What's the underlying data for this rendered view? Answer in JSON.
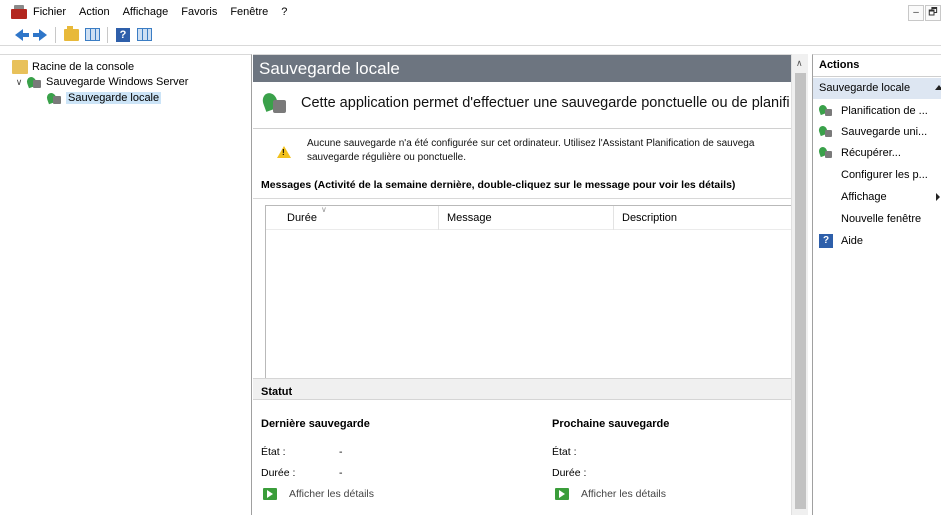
{
  "menu": {
    "items": [
      "Fichier",
      "Action",
      "Affichage",
      "Favoris",
      "Fenêtre",
      "?"
    ]
  },
  "window_controls": [
    "–",
    "🗗"
  ],
  "toolbar": {
    "buttons": [
      "back-arrow-icon",
      "forward-arrow-icon",
      "folder-up-icon",
      "show-hide-tree-icon",
      "help-icon",
      "show-hide-action-pane-icon"
    ]
  },
  "tree": {
    "items": [
      {
        "label": "Racine de la console",
        "icon": "folder-icon"
      },
      {
        "label": "Sauvegarde Windows Server",
        "icon": "windows-backup-icon",
        "expanded": true
      },
      {
        "label": "Sauvegarde locale",
        "icon": "windows-backup-icon",
        "selected": true
      }
    ]
  },
  "center": {
    "title": "Sauvegarde locale",
    "intro": "Cette application permet d'effectuer une sauvegarde ponctuelle ou de planifi",
    "warning": {
      "line1": "Aucune sauvegarde n'a été configurée sur cet ordinateur. Utilisez l'Assistant Planification de sauvega",
      "line2": "sauvegarde régulière ou ponctuelle."
    },
    "messages_title": "Messages (Activité de la semaine dernière, double-cliquez sur le message pour voir les détails)",
    "columns": [
      "Durée",
      "Message",
      "Description"
    ],
    "rows": [],
    "statut_title": "Statut",
    "last_backup": {
      "title": "Dernière sauvegarde",
      "state_label": "État :",
      "state_value": "-",
      "duration_label": "Durée :",
      "duration_value": "-",
      "details": "Afficher les détails"
    },
    "next_backup": {
      "title": "Prochaine sauvegarde",
      "state_label": "État :",
      "duration_label": "Durée :",
      "details": "Afficher les détails"
    }
  },
  "actions": {
    "title": "Actions",
    "group": "Sauvegarde locale",
    "items": [
      {
        "label": "Planification de ...",
        "icon": "schedule-backup-icon"
      },
      {
        "label": "Sauvegarde uni...",
        "icon": "backup-once-icon"
      },
      {
        "label": "Récupérer...",
        "icon": "recover-icon"
      },
      {
        "label": "Configurer les p...",
        "icon": "none"
      },
      {
        "label": "Affichage",
        "icon": "none",
        "submenu": true
      },
      {
        "label": "Nouvelle fenêtre",
        "icon": "none"
      },
      {
        "label": "Aide",
        "icon": "help-icon"
      }
    ]
  },
  "colors": {
    "title_bar": "#6d7580",
    "selection": "#cce4f7",
    "actions_group": "#dde6f2",
    "warning": "#f2c11b",
    "backup_green": "#3aa14a"
  }
}
